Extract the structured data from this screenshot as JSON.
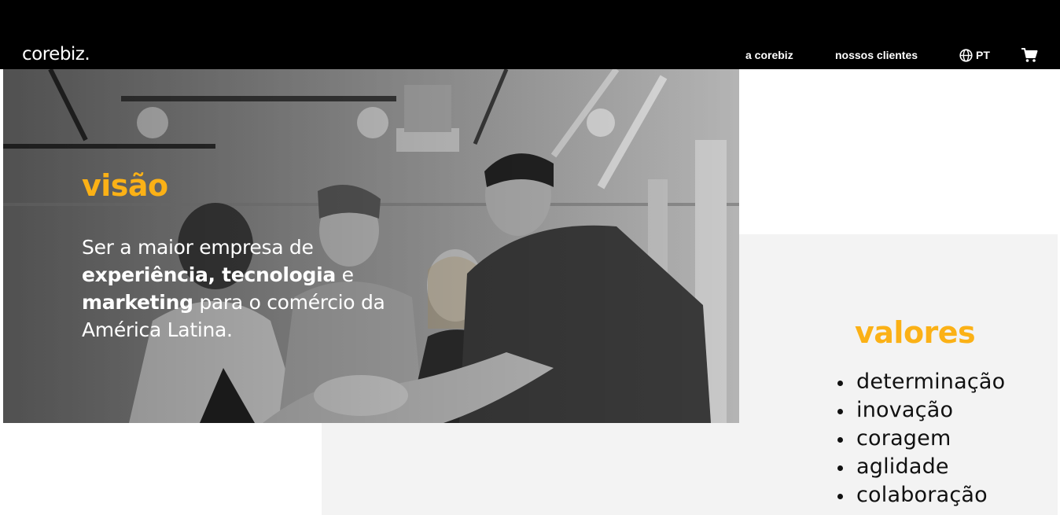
{
  "header": {
    "logo_text": "corebiz",
    "logo_dot": ".",
    "nav": [
      {
        "label": "a corebiz"
      },
      {
        "label": "nossos clientes"
      }
    ],
    "language": {
      "label": "PT",
      "icon": "globe-icon"
    },
    "cart": {
      "icon": "cart-icon"
    }
  },
  "visao": {
    "title": "visão",
    "text_parts": [
      "Ser a maior empresa de ",
      "experiência, tecnologia",
      " e ",
      "marketing",
      " para o comércio da América Latina."
    ]
  },
  "valores": {
    "title": "valores",
    "items": [
      "determinação",
      "inovação",
      "coragem",
      "aglidade",
      "colaboração"
    ]
  },
  "colors": {
    "accent": "#fbb116",
    "header_bg": "#000000",
    "panel_bg": "#f3f3f3"
  }
}
